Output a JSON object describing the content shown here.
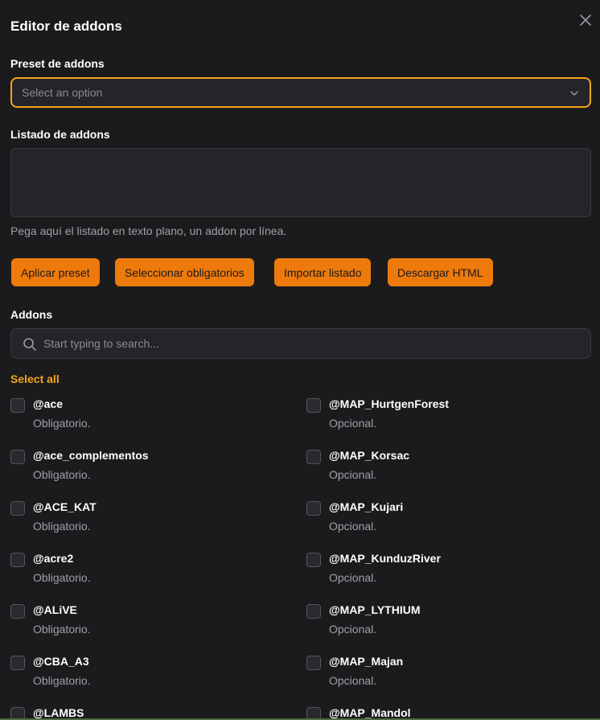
{
  "modal": {
    "title": "Editor de addons",
    "preset_label": "Preset de addons",
    "preset_placeholder": "Select an option",
    "list_label": "Listado de addons",
    "list_value": "",
    "helper_text": "Pega aquí el listado en texto plano, un addon por línea.",
    "buttons": {
      "apply": "Aplicar preset",
      "select_required": "Seleccionar obligatorios",
      "import": "Importar listado",
      "download": "Descargar HTML"
    },
    "addons_label": "Addons",
    "search_placeholder": "Start typing to search...",
    "select_all": "Select all",
    "accent_color": "#f3a418",
    "button_color": "#ee7a0c"
  },
  "addons_left": [
    {
      "name": "@ace",
      "desc": "Obligatorio.",
      "checked": false
    },
    {
      "name": "@ace_complementos",
      "desc": "Obligatorio.",
      "checked": false
    },
    {
      "name": "@ACE_KAT",
      "desc": "Obligatorio.",
      "checked": false
    },
    {
      "name": "@acre2",
      "desc": "Obligatorio.",
      "checked": false
    },
    {
      "name": "@ALiVE",
      "desc": "Obligatorio.",
      "checked": false
    },
    {
      "name": "@CBA_A3",
      "desc": "Obligatorio.",
      "checked": false
    },
    {
      "name": "@LAMBS",
      "desc": "",
      "checked": false
    }
  ],
  "addons_right": [
    {
      "name": "@MAP_HurtgenForest",
      "desc": "Opcional.",
      "checked": false
    },
    {
      "name": "@MAP_Korsac",
      "desc": "Opcional.",
      "checked": false
    },
    {
      "name": "@MAP_Kujari",
      "desc": "Opcional.",
      "checked": false
    },
    {
      "name": "@MAP_KunduzRiver",
      "desc": "Opcional.",
      "checked": false
    },
    {
      "name": "@MAP_LYTHIUM",
      "desc": "Opcional.",
      "checked": false
    },
    {
      "name": "@MAP_Majan",
      "desc": "Opcional.",
      "checked": false
    },
    {
      "name": "@MAP_Mandol",
      "desc": "",
      "checked": false
    }
  ]
}
